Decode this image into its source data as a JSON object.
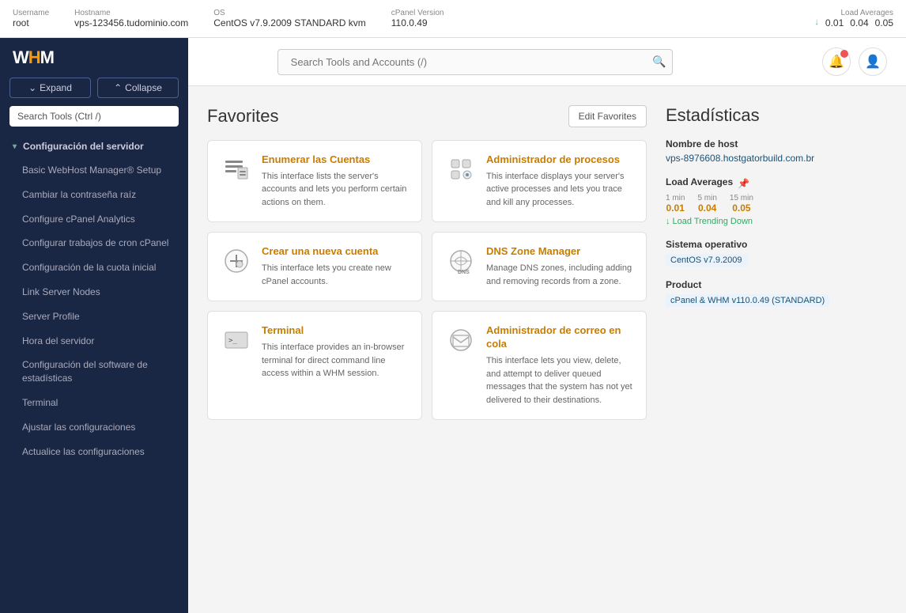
{
  "topbar": {
    "username_label": "Username",
    "username_value": "root",
    "hostname_label": "Hostname",
    "hostname_value": "vps-123456.tudominio.com",
    "os_label": "OS",
    "os_value": "CentOS v7.9.2009 STANDARD kvm",
    "cpanel_label": "cPanel Version",
    "cpanel_value": "110.0.49",
    "load_label": "Load Averages",
    "load_down": "↓",
    "load_1": "0.01",
    "load_5": "0.04",
    "load_15": "0.05"
  },
  "sidebar": {
    "logo": "WHM",
    "expand_label": "Expand",
    "collapse_label": "Collapse",
    "search_placeholder": "Search Tools (Ctrl /)",
    "section_label": "Configuración del servidor",
    "items": [
      {
        "label": "Basic WebHost Manager® Setup"
      },
      {
        "label": "Cambiar la contraseña raíz"
      },
      {
        "label": "Configure cPanel Analytics"
      },
      {
        "label": "Configurar trabajos de cron cPanel"
      },
      {
        "label": "Configuración de la cuota inicial"
      },
      {
        "label": "Link Server Nodes"
      },
      {
        "label": "Server Profile"
      },
      {
        "label": "Hora del servidor"
      },
      {
        "label": "Configuración del software de estadísticas"
      },
      {
        "label": "Terminal"
      },
      {
        "label": "Ajustar las configuraciones"
      },
      {
        "label": "Actualice las configuraciones"
      }
    ]
  },
  "header": {
    "search_placeholder": "Search Tools and Accounts (/)"
  },
  "favorites": {
    "title": "Favorites",
    "edit_label": "Edit Favorites",
    "cards": [
      {
        "title": "Enumerar las Cuentas",
        "desc": "This interface lists the server's accounts and lets you perform certain actions on them.",
        "icon": "list-accounts"
      },
      {
        "title": "Administrador de procesos",
        "desc": "This interface displays your server's active processes and lets you trace and kill any processes.",
        "icon": "process-manager"
      },
      {
        "title": "Crear una nueva cuenta",
        "desc": "This interface lets you create new cPanel accounts.",
        "icon": "create-account"
      },
      {
        "title": "DNS Zone Manager",
        "desc": "Manage DNS zones, including adding and removing records from a zone.",
        "icon": "dns-manager"
      },
      {
        "title": "Terminal",
        "desc": "This interface provides an in-browser terminal for direct command line access within a WHM session.",
        "icon": "terminal"
      },
      {
        "title": "Administrador de correo en cola",
        "desc": "This interface lets you view, delete, and attempt to deliver queued messages that the system has not yet delivered to their destinations.",
        "icon": "mail-queue"
      }
    ]
  },
  "stats": {
    "title": "Estadísticas",
    "hostname_label": "Nombre de host",
    "hostname_value": "vps-8976608.hostgatorbuild.com.br",
    "load_avg_label": "Load Averages",
    "load_periods": [
      "1 min",
      "5 min",
      "15 min"
    ],
    "load_values": [
      "0.01",
      "0.04",
      "0.05"
    ],
    "trending_label": "Load Trending Down",
    "os_label": "Sistema operativo",
    "os_value": "CentOS v7.9.2009",
    "product_label": "Product",
    "product_value": "cPanel & WHM v110.0.49 (STANDARD)"
  }
}
